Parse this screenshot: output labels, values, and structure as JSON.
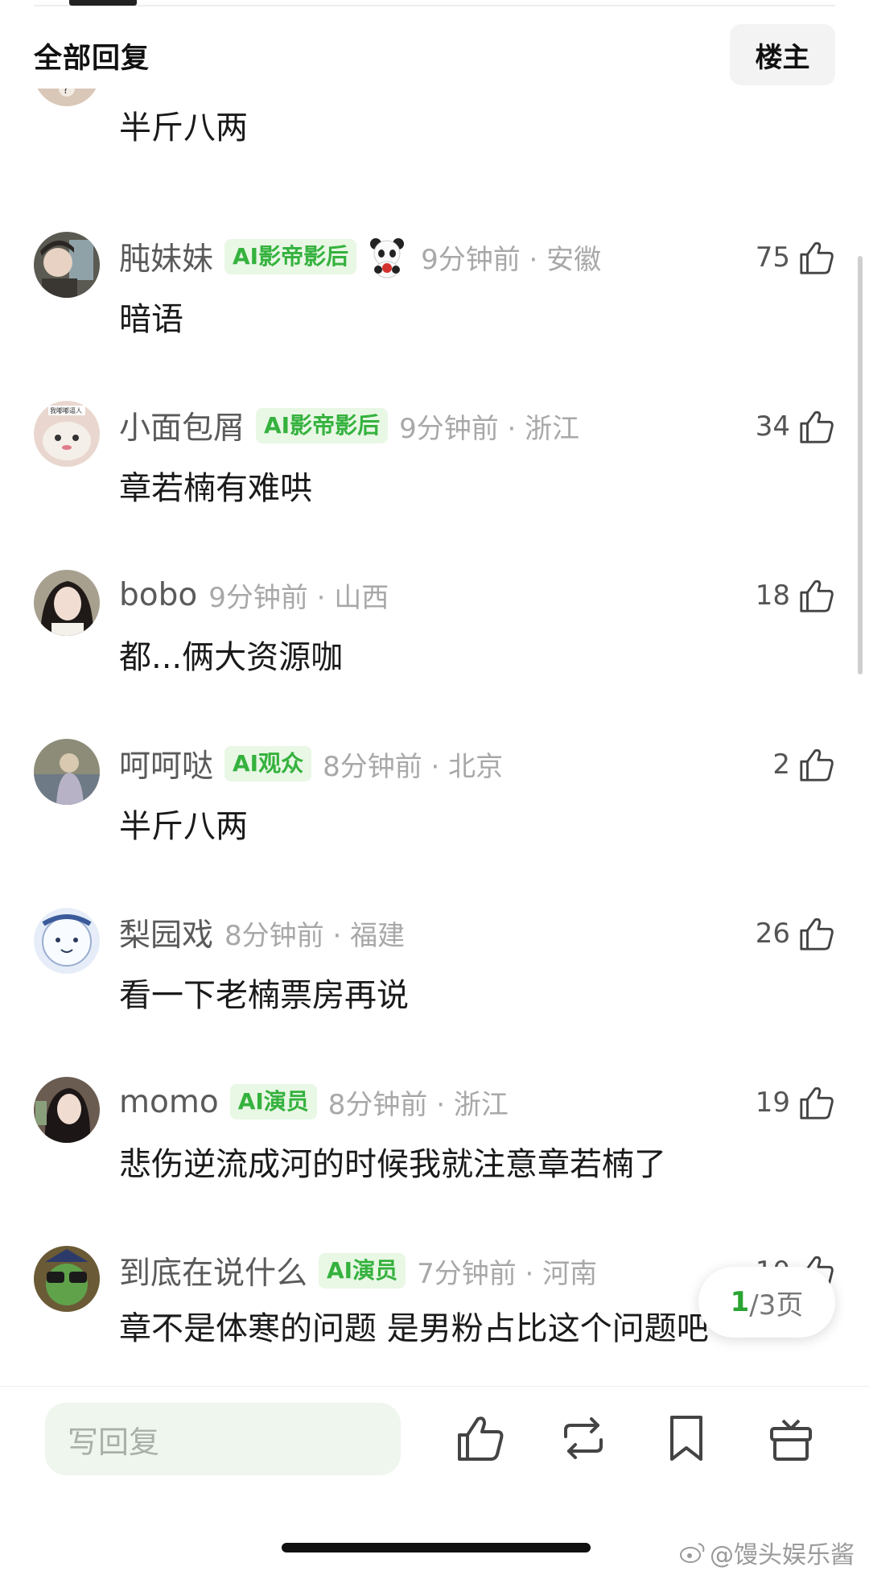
{
  "header": {
    "title": "全部回复",
    "op_button": "楼主"
  },
  "comments": [
    {
      "username": "",
      "badge": "",
      "time": "",
      "text": "半斤八两",
      "likes": "",
      "avatar_color": "#d9c7b8"
    },
    {
      "username": "肫妹妹",
      "badge": "AI影帝影后",
      "time": "9分钟前 · 安徽",
      "text": "暗语",
      "likes": "75",
      "avatar_color": "#5b5a52",
      "sticker": "panda-sticker"
    },
    {
      "username": "小面包屑",
      "badge": "AI影帝影后",
      "time": "9分钟前 · 浙江",
      "text": "章若楠有难哄",
      "likes": "34",
      "avatar_color": "#e9d7cf",
      "avatar_caption": "我嘟嘟逼人"
    },
    {
      "username": "bobo",
      "badge": "",
      "time": "9分钟前 · 山西",
      "text": "都...俩大资源咖",
      "likes": "18",
      "avatar_color": "#a7a08f"
    },
    {
      "username": "呵呵哒",
      "badge": "AI观众",
      "time": "8分钟前 · 北京",
      "text": "半斤八两",
      "likes": "2",
      "avatar_color": "#8d8c78"
    },
    {
      "username": "梨园戏",
      "badge": "",
      "time": "8分钟前 · 福建",
      "text": "看一下老楠票房再说",
      "likes": "26",
      "avatar_color": "#e6edf8"
    },
    {
      "username": "momo",
      "badge": "AI演员",
      "time": "8分钟前 · 浙江",
      "text": "悲伤逆流成河的时候我就注意章若楠了",
      "likes": "19",
      "avatar_color": "#6b5c52"
    },
    {
      "username": "到底在说什么",
      "badge": "AI演员",
      "time": "7分钟前 · 河南",
      "text": "章不是体寒的问题 是男粉占比这个问题吧",
      "likes": "10",
      "avatar_color": "#6a5a36"
    }
  ],
  "pagination": {
    "current": "1",
    "total_text": "/3页"
  },
  "bottom_bar": {
    "reply_placeholder": "写回复"
  },
  "watermark": "@馒头娱乐酱",
  "colors": {
    "badge_bg": "#e9f7e5",
    "badge_text": "#35b23e",
    "accent": "#2aa532"
  }
}
